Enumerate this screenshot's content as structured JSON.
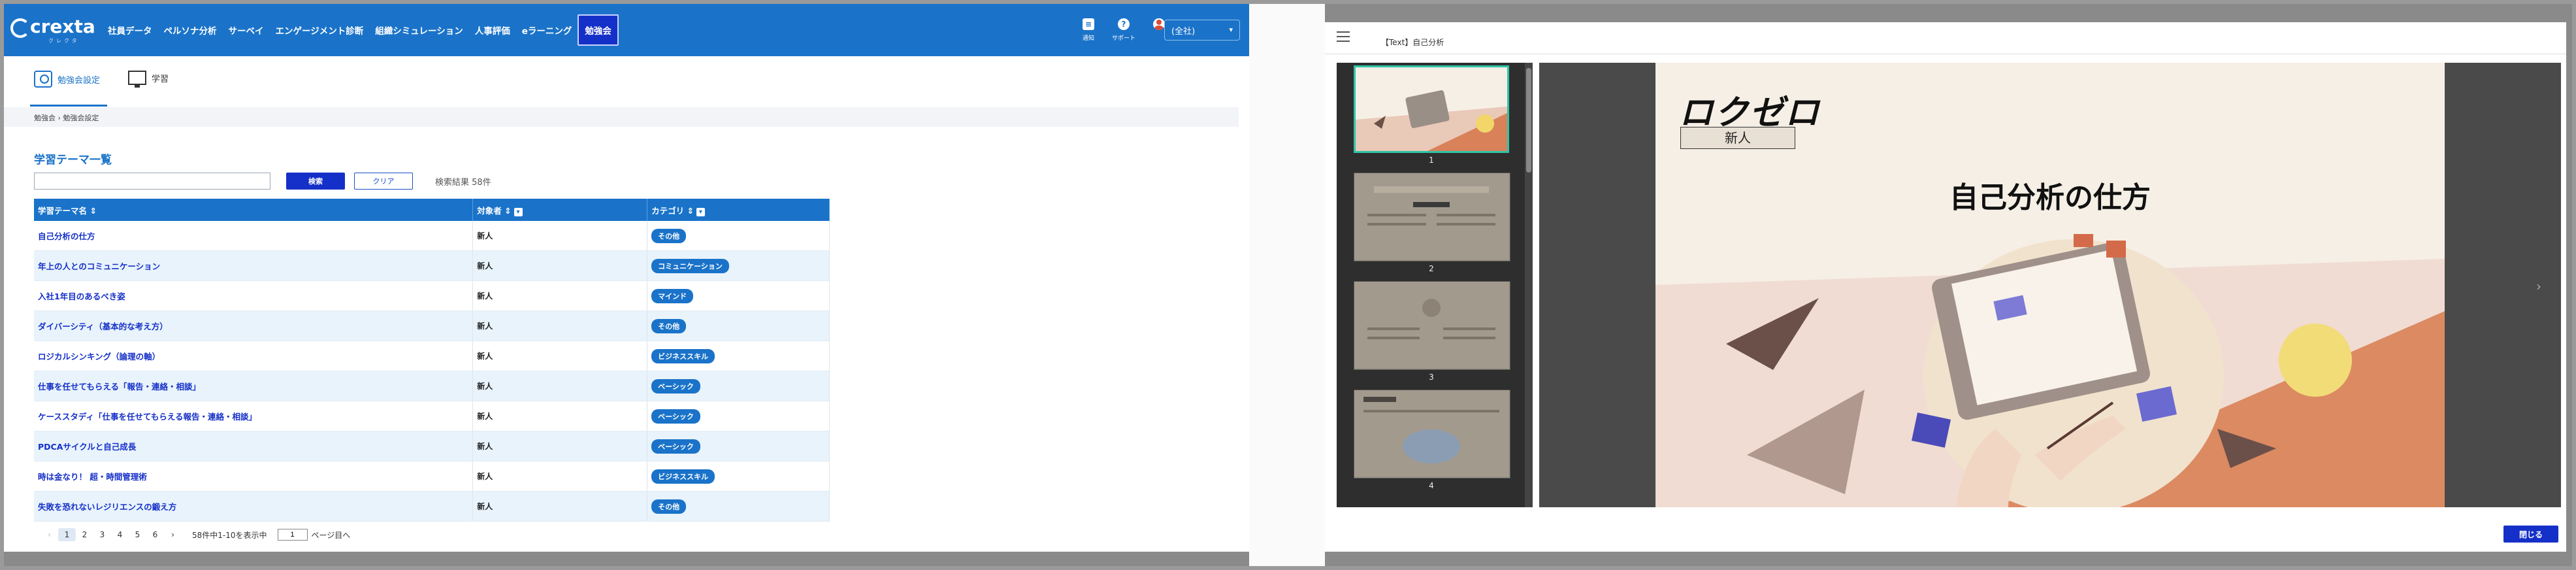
{
  "app": {
    "logo_text": "crexta",
    "logo_sub": "クレクタ",
    "nav": [
      "社員データ",
      "ペルソナ分析",
      "サーベイ",
      "エンゲージメント診断",
      "組織シミュレーション",
      "人事評価",
      "eラーニング",
      "勉強会"
    ],
    "active_nav": "勉強会",
    "icons": [
      {
        "icon": "chat-icon",
        "label": "通知"
      },
      {
        "icon": "help-icon",
        "label": "サポート"
      },
      {
        "icon": "avatar-icon",
        "label": ""
      }
    ],
    "org_select": "(全社)"
  },
  "subtabs": [
    {
      "label": "勉強会設定",
      "icon": "study-settings-icon",
      "active": true
    },
    {
      "label": "学習",
      "icon": "monitor-icon",
      "active": false
    }
  ],
  "breadcrumb": "勉強会 › 勉強会設定",
  "list": {
    "title": "学習テーマ一覧",
    "search_placeholder": "",
    "search_label": "検索",
    "clear_label": "クリア",
    "result_count": "検索結果 58件",
    "headers": [
      "学習テーマ名 ⇕",
      "対象者 ⇕",
      "カテゴリ ⇕"
    ],
    "rows": [
      {
        "theme": "自己分析の仕方",
        "target": "新人",
        "category": "その他"
      },
      {
        "theme": "年上の人とのコミュニケーション",
        "target": "新人",
        "category": "コミュニケーション"
      },
      {
        "theme": "入社1年目のあるべき姿",
        "target": "新人",
        "category": "マインド"
      },
      {
        "theme": "ダイバーシティ（基本的な考え方）",
        "target": "新人",
        "category": "その他"
      },
      {
        "theme": "ロジカルシンキング（論理の軸）",
        "target": "新人",
        "category": "ビジネススキル"
      },
      {
        "theme": "仕事を任せてもらえる「報告・連絡・相談」",
        "target": "新人",
        "category": "ベーシック"
      },
      {
        "theme": "ケーススタディ「仕事を任せてもらえる報告・連絡・相談」",
        "target": "新人",
        "category": "ベーシック"
      },
      {
        "theme": "PDCAサイクルと自己成長",
        "target": "新人",
        "category": "ベーシック"
      },
      {
        "theme": "時は金なり！ 超・時間管理術",
        "target": "新人",
        "category": "ビジネススキル"
      },
      {
        "theme": "失敗を恐れないレジリエンスの鍛え方",
        "target": "新人",
        "category": "その他"
      }
    ],
    "pager": {
      "prev": "‹",
      "pages": [
        "1",
        "2",
        "3",
        "4",
        "5",
        "6"
      ],
      "current": "1",
      "next": "›",
      "info": "58件中1-10を表示中",
      "jump_value": "1",
      "jump_suffix": "ページ目へ"
    }
  },
  "viewer": {
    "title": "【Text】自己分析",
    "thumb_numbers": [
      "1",
      "2",
      "3",
      "4"
    ],
    "slide": {
      "logo": "ロクゼロ",
      "tag": "新人",
      "title": "自己分析の仕方"
    },
    "close_label": "閉じる"
  }
}
